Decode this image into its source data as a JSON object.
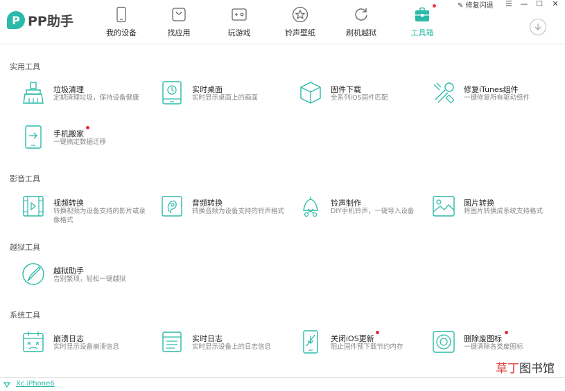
{
  "app": {
    "logo_mark": "P",
    "title": "PP助手"
  },
  "nav": {
    "items": [
      {
        "label": "我的设备",
        "icon": "phone-icon"
      },
      {
        "label": "找应用",
        "icon": "app-bag-icon"
      },
      {
        "label": "玩游戏",
        "icon": "gamepad-icon"
      },
      {
        "label": "铃声壁纸",
        "icon": "star-icon"
      },
      {
        "label": "刷机越狱",
        "icon": "refresh-icon"
      },
      {
        "label": "工具箱",
        "icon": "toolbox-icon",
        "active": true,
        "badge": true
      }
    ]
  },
  "top_controls": {
    "repair_label": "修复闪退",
    "menu": "☰",
    "minimize": "—",
    "maximize": "☐",
    "close": "✕"
  },
  "sections": [
    {
      "title": "实用工具",
      "tools": [
        {
          "name": "垃圾清理",
          "desc": "定期清理垃圾，保持设备健康",
          "icon": "broom-icon"
        },
        {
          "name": "实时桌面",
          "desc": "实时显示桌面上的画面",
          "icon": "tablet-clock-icon"
        },
        {
          "name": "固件下载",
          "desc": "全系列iOS固件匹配",
          "icon": "cube-icon"
        },
        {
          "name": "修复iTunes组件",
          "desc": "一键修复所有驱动组件",
          "icon": "wrench-icon"
        },
        {
          "name": "手机搬家",
          "desc": "一键搞定数据迁移",
          "icon": "phone-transfer-icon",
          "badge": true
        }
      ]
    },
    {
      "title": "影音工具",
      "tools": [
        {
          "name": "视频转换",
          "desc": "转换视频为设备支持的影片或录像格式",
          "icon": "film-icon"
        },
        {
          "name": "音频转换",
          "desc": "转换音频为设备支持的铃声格式",
          "icon": "audio-icon"
        },
        {
          "name": "铃声制作",
          "desc": "DIY手机铃声，一键导入设备",
          "icon": "bell-scissors-icon"
        },
        {
          "name": "图片转换",
          "desc": "将图片转换成系统支持格式",
          "icon": "picture-icon"
        }
      ]
    },
    {
      "title": "越狱工具",
      "tools": [
        {
          "name": "越狱助手",
          "desc": "告别繁琐，轻松一键越狱",
          "icon": "jailbreak-pen-icon"
        }
      ]
    },
    {
      "title": "系统工具",
      "tools": [
        {
          "name": "崩溃日志",
          "desc": "实时显示设备崩溃信息",
          "icon": "crash-calendar-icon"
        },
        {
          "name": "实时日志",
          "desc": "实时显示设备上的日志信息",
          "icon": "log-list-icon"
        },
        {
          "name": "关闭iOS更新",
          "desc": "阻止固件预下载节约内存",
          "icon": "phone-block-icon",
          "badge": true
        },
        {
          "name": "删除废图标",
          "desc": "一键清除各类废图标",
          "icon": "trash-circle-icon",
          "badge": true
        }
      ]
    }
  ],
  "footer": {
    "device_name": "Xc iPhone6"
  },
  "watermark": {
    "part1": "草丁",
    "part2": "图书馆"
  },
  "colors": {
    "accent": "#2bbaa9",
    "badge": "#e8283c"
  }
}
